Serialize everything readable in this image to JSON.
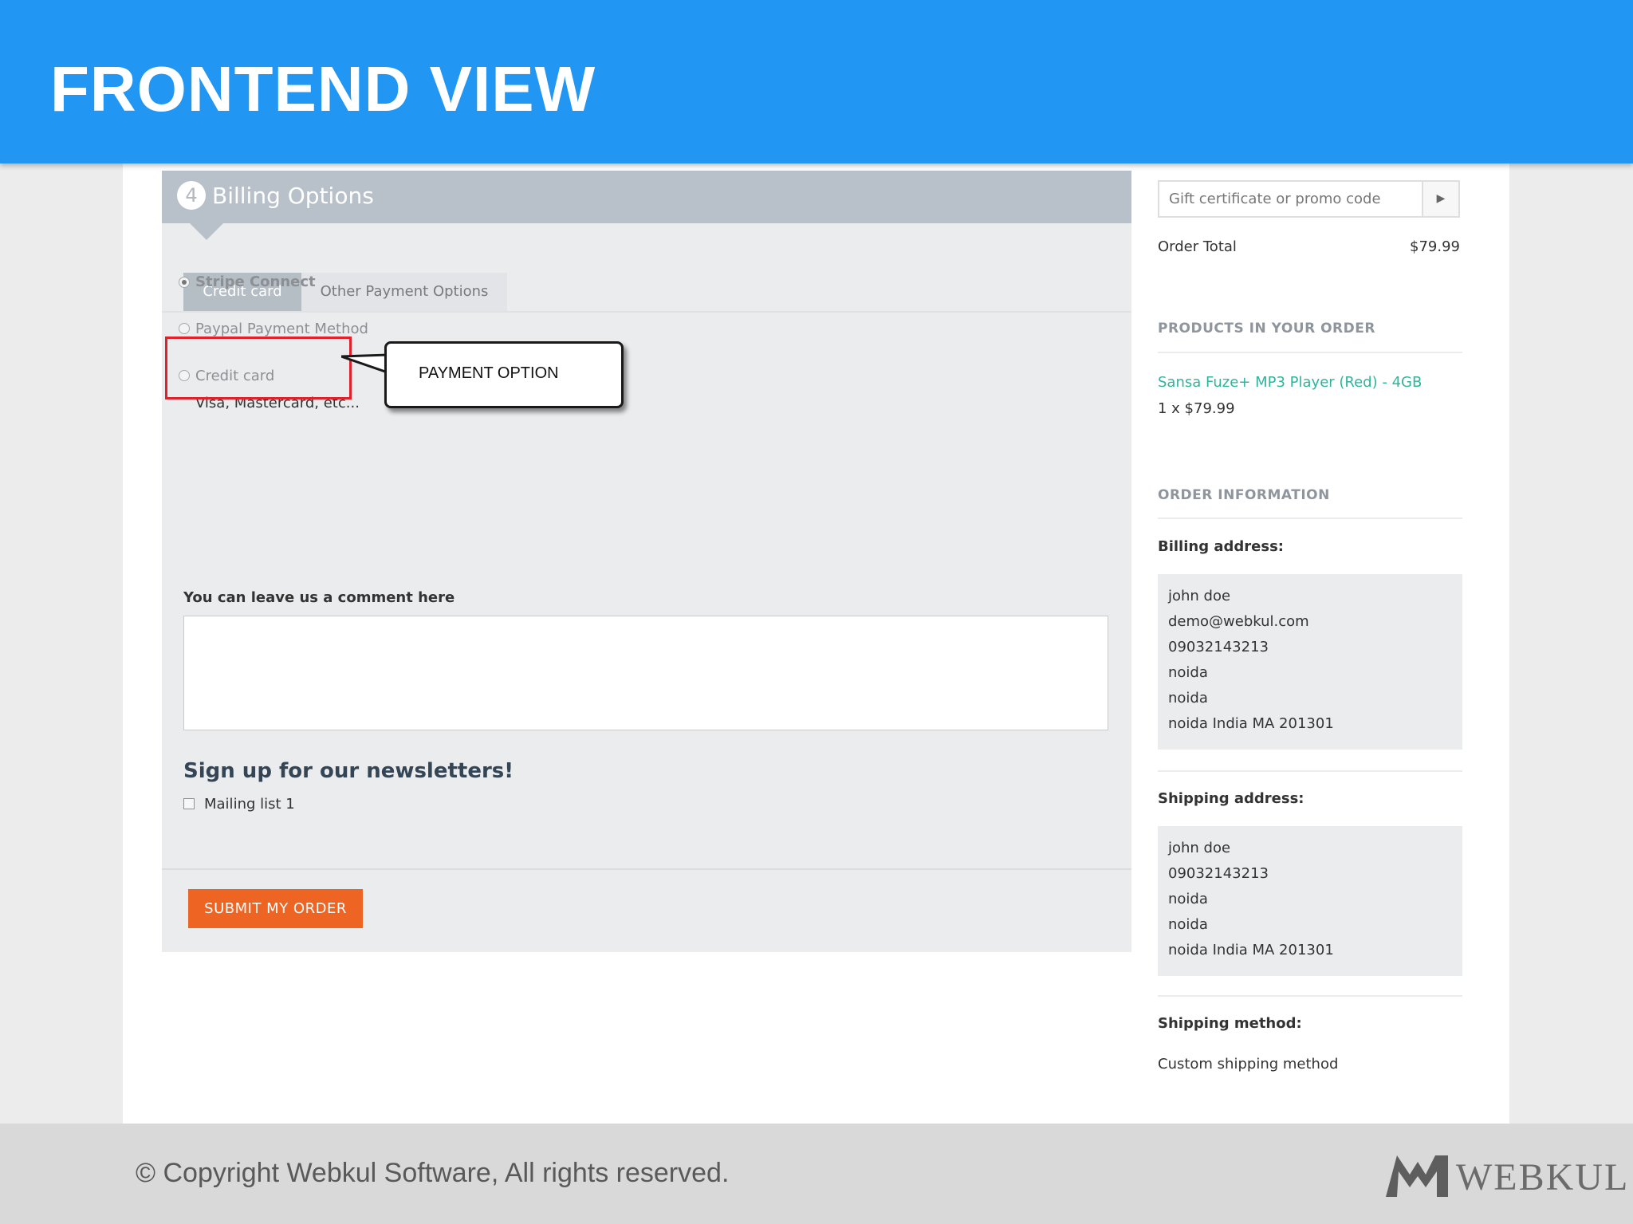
{
  "slide": {
    "title": "FRONTEND VIEW",
    "copyright": "© Copyright Webkul Software, All rights reserved.",
    "logo_text": "WEBKUL",
    "banner_color": "#2196f3"
  },
  "billing": {
    "step_number": "4",
    "title": "Billing Options",
    "tabs": [
      {
        "label": "Credit card",
        "active": true
      },
      {
        "label": "Other Payment Options",
        "active": false
      }
    ],
    "payment_options": [
      {
        "label": "Stripe Connect",
        "selected": true,
        "description": ""
      },
      {
        "label": "Paypal Payment Method",
        "selected": false,
        "description": ""
      },
      {
        "label": "Credit card",
        "selected": false,
        "description": "Visa, Mastercard, etc..."
      }
    ],
    "callout_text": "PAYMENT OPTION",
    "comment_label": "You can leave us a comment here",
    "comment_value": "",
    "newsletter_title": "Sign up for our newsletters!",
    "mailing_list_label": "Mailing list 1",
    "mailing_list_checked": false,
    "submit_label": "SUBMIT MY ORDER",
    "submit_color": "#ee6422"
  },
  "sidebar": {
    "promo_placeholder": "Gift certificate or promo code",
    "promo_button_icon": "play-arrow-icon",
    "order_total_label": "Order Total",
    "order_total_value": "$79.99",
    "products_heading": "PRODUCTS IN YOUR ORDER",
    "product_name": "Sansa Fuze+ MP3 Player (Red) - 4GB",
    "product_qty": "1 x $79.99",
    "order_info_heading": "ORDER INFORMATION",
    "billing_address_label": "Billing address:",
    "billing_address": [
      "john doe",
      "demo@webkul.com",
      "09032143213",
      "noida",
      "noida",
      "noida India MA 201301"
    ],
    "shipping_address_label": "Shipping address:",
    "shipping_address": [
      "john doe",
      "09032143213",
      "noida",
      "noida",
      "noida India MA 201301"
    ],
    "shipping_method_label": "Shipping method:",
    "shipping_method": "Custom shipping method"
  }
}
